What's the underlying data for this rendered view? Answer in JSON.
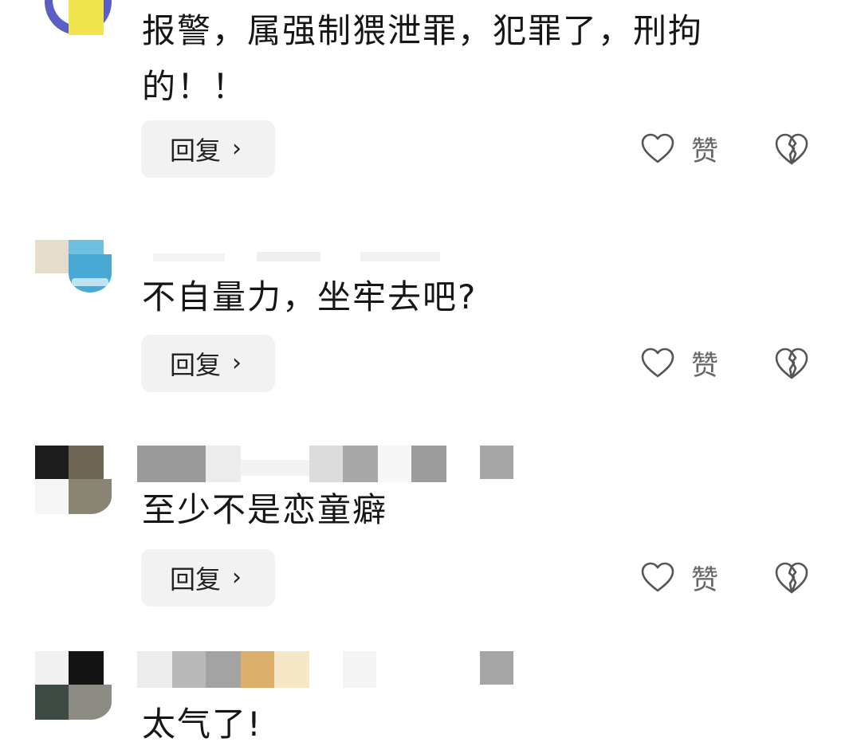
{
  "comments": [
    {
      "text": "报警，属强制猥泄罪，犯罪了，刑拘的！！",
      "line1": "报警，属强制猥泄罪，犯罪了，刑拘",
      "line2": "的！！",
      "reply_label": "回复",
      "like_label": "赞"
    },
    {
      "text": "不自量力，坐牢去吧?",
      "reply_label": "回复",
      "like_label": "赞"
    },
    {
      "text": "至少不是恋童癖",
      "reply_label": "回复",
      "like_label": "赞"
    },
    {
      "text": "太气了!"
    }
  ],
  "icons": {
    "reply_chevron": "chevron-right-icon",
    "like": "heart-outline-icon",
    "dislike": "broken-heart-icon"
  },
  "colors": {
    "reply_bg": "#f2f2f2",
    "icon_stroke": "#555555",
    "text": "#161616",
    "label_gray": "#666666"
  }
}
